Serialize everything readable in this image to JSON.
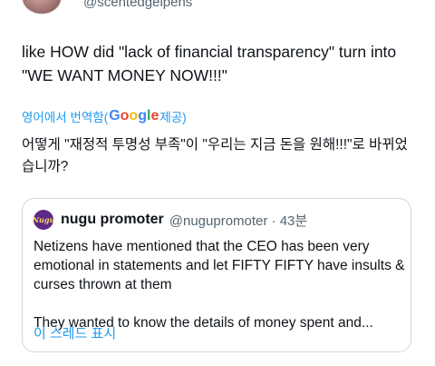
{
  "author": {
    "handle": "@scentedgelpens"
  },
  "tweet": {
    "text": "like HOW did \"lack of financial transparency\" turn into \"WE WANT MONEY NOW!!!\""
  },
  "translation": {
    "prefix": "영어에서 번역함(",
    "google_letters": [
      "G",
      "o",
      "o",
      "g",
      "l",
      "e"
    ],
    "suffix": " 제공)",
    "text": "어떻게 \"재정적 투명성 부족\"이 \"우리는 지금 돈을 원해!!!\"로 바뀌었습니까?"
  },
  "quote": {
    "avatar_label": "Nugu",
    "name": "nugu promoter",
    "meta": "@nugupromoter · 43분",
    "paragraph1": "Netizens have mentioned that the CEO has been very emotional in statements and let FIFTY FIFTY have insults & curses thrown at them",
    "paragraph2": "They wanted to know the details of money spent and...",
    "show_thread": "이 스레드 표시"
  },
  "colors": {
    "link": "#1d9bf0",
    "text": "#0f1419",
    "secondary": "#536471",
    "border": "#cfd9de",
    "google_blue": "#4285f4",
    "google_red": "#ea4335",
    "google_yellow": "#fbbc05",
    "google_green": "#34a853"
  }
}
